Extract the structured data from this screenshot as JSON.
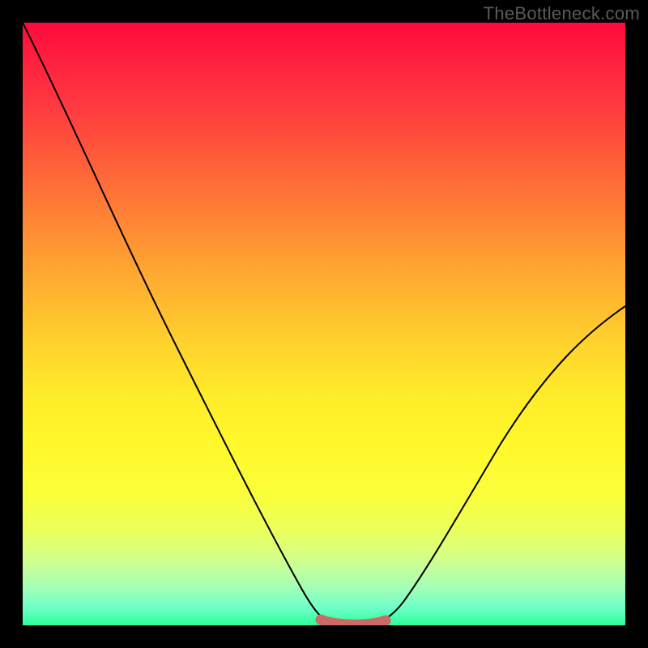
{
  "watermark": "TheBottleneck.com",
  "chart_data": {
    "type": "line",
    "title": "",
    "xlabel": "",
    "ylabel": "",
    "xlim": [
      0,
      100
    ],
    "ylim": [
      0,
      100
    ],
    "grid": false,
    "series": [
      {
        "name": "bottleneck-curve",
        "x": [
          0,
          10,
          20,
          30,
          40,
          47,
          50,
          55,
          58,
          60,
          62,
          65,
          70,
          80,
          90,
          100
        ],
        "values": [
          100,
          79.0,
          58.0,
          37.5,
          17.0,
          4.0,
          1.0,
          0.3,
          0.4,
          0.8,
          1.5,
          3.5,
          8.5,
          22.0,
          37.0,
          53.0
        ]
      },
      {
        "name": "optimal-range-marker",
        "x": [
          50,
          52,
          55,
          58,
          60
        ],
        "values": [
          1.0,
          0.5,
          0.3,
          0.4,
          0.8
        ]
      }
    ],
    "colors": {
      "curve": "#000000",
      "marker": "#cc6a66",
      "gradient_top": "#ff0a3a",
      "gradient_bottom": "#2aff9a"
    }
  }
}
